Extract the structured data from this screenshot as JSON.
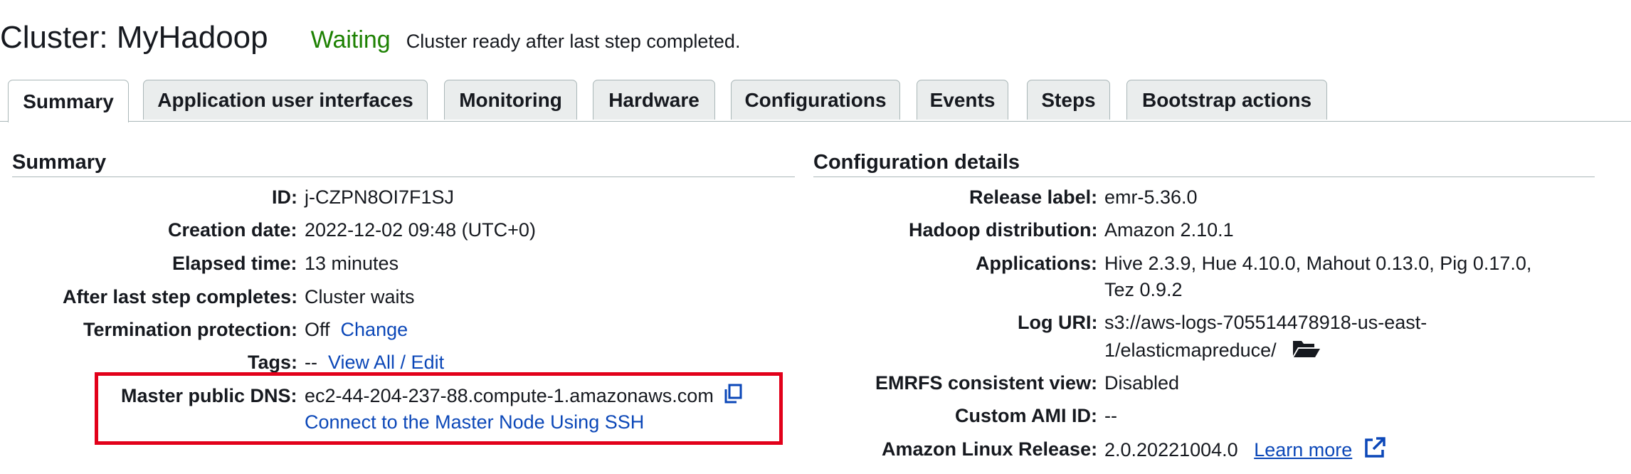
{
  "header": {
    "title": "Cluster: MyHadoop",
    "status": "Waiting",
    "status_message": "Cluster ready after last step completed.",
    "status_color": "#1d8102"
  },
  "tabs": [
    {
      "label": "Summary",
      "active": true
    },
    {
      "label": "Application user interfaces"
    },
    {
      "label": "Monitoring"
    },
    {
      "label": "Hardware"
    },
    {
      "label": "Configurations"
    },
    {
      "label": "Events"
    },
    {
      "label": "Steps"
    },
    {
      "label": "Bootstrap actions"
    }
  ],
  "summary": {
    "title": "Summary",
    "id_label": "ID:",
    "id_value": "j-CZPN8OI7F1SJ",
    "creation_label": "Creation date:",
    "creation_value": "2022-12-02 09:48 (UTC+0)",
    "elapsed_label": "Elapsed time:",
    "elapsed_value": "13 minutes",
    "after_label": "After last step completes:",
    "after_value": "Cluster waits",
    "termination_label": "Termination protection:",
    "termination_value": "Off",
    "termination_link": "Change",
    "tags_label": "Tags:",
    "tags_value": "--",
    "tags_link": "View All / Edit",
    "dns_label": "Master public DNS:",
    "dns_value": "ec2-44-204-237-88.compute-1.amazonaws.com",
    "dns_copy_icon": "copy-icon",
    "ssh_link": "Connect to the Master Node Using SSH"
  },
  "config": {
    "title": "Configuration details",
    "release_label": "Release label:",
    "release_value": "emr-5.36.0",
    "hadoop_label": "Hadoop distribution:",
    "hadoop_value": "Amazon 2.10.1",
    "apps_label": "Applications:",
    "apps_value_line1": "Hive 2.3.9, Hue 4.10.0, Mahout 0.13.0, Pig 0.17.0,",
    "apps_value_line2": "Tez 0.9.2",
    "log_label": "Log URI:",
    "log_value_line1": "s3://aws-logs-705514478918-us-east-",
    "log_value_line2": "1/elasticmapreduce/",
    "log_icon": "folder-icon",
    "emrfs_label": "EMRFS consistent view:",
    "emrfs_value": "Disabled",
    "ami_label": "Custom AMI ID:",
    "ami_value": "--",
    "linux_label": "Amazon Linux Release:",
    "linux_value": "2.0.20221004.0",
    "linux_link": "Learn more",
    "linux_link_icon": "external-link-icon"
  },
  "colors": {
    "link": "#0b47b8",
    "highlight_border": "#e2001a"
  }
}
